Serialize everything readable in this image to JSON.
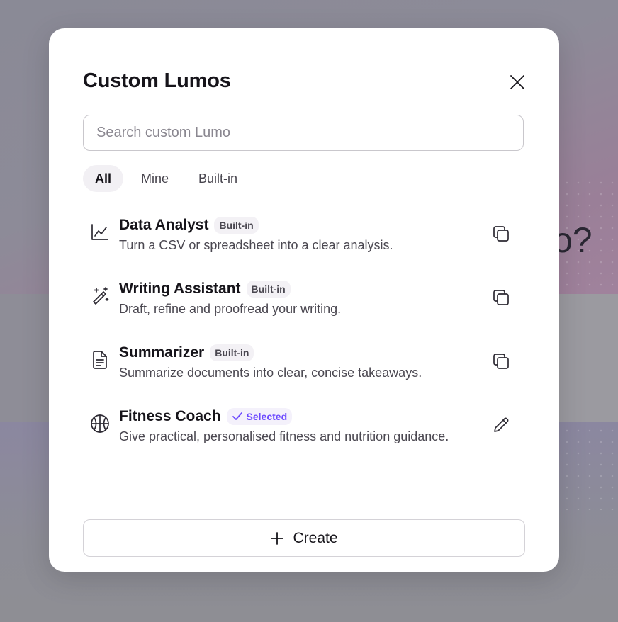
{
  "backdrop": {
    "heading_fragment": "o?"
  },
  "modal": {
    "title": "Custom Lumos",
    "close_icon": "close-icon"
  },
  "search": {
    "placeholder": "Search custom Lumo",
    "value": ""
  },
  "tabs": [
    {
      "label": "All",
      "active": true
    },
    {
      "label": "Mine",
      "active": false
    },
    {
      "label": "Built-in",
      "active": false
    }
  ],
  "items": [
    {
      "name": "Data Analyst",
      "badge": "Built-in",
      "description": "Turn a CSV or spreadsheet into a clear analysis.",
      "icon": "chart-line-icon",
      "action_icon": "copy-icon"
    },
    {
      "name": "Writing Assistant",
      "badge": "Built-in",
      "description": "Draft, refine and proofread your writing.",
      "icon": "magic-wand-icon",
      "action_icon": "copy-icon"
    },
    {
      "name": "Summarizer",
      "badge": "Built-in",
      "description": "Summarize documents into clear, concise takeaways.",
      "icon": "document-icon",
      "action_icon": "copy-icon"
    },
    {
      "name": "Fitness Coach",
      "badge": "Selected",
      "description": "Give practical, personalised fitness and nutrition guidance.",
      "icon": "basketball-icon",
      "action_icon": "pencil-icon"
    }
  ],
  "create_button": {
    "label": "Create",
    "icon": "plus-icon"
  },
  "colors": {
    "accent": "#6d4aff",
    "text": "#16141a",
    "muted": "#4b4851"
  }
}
